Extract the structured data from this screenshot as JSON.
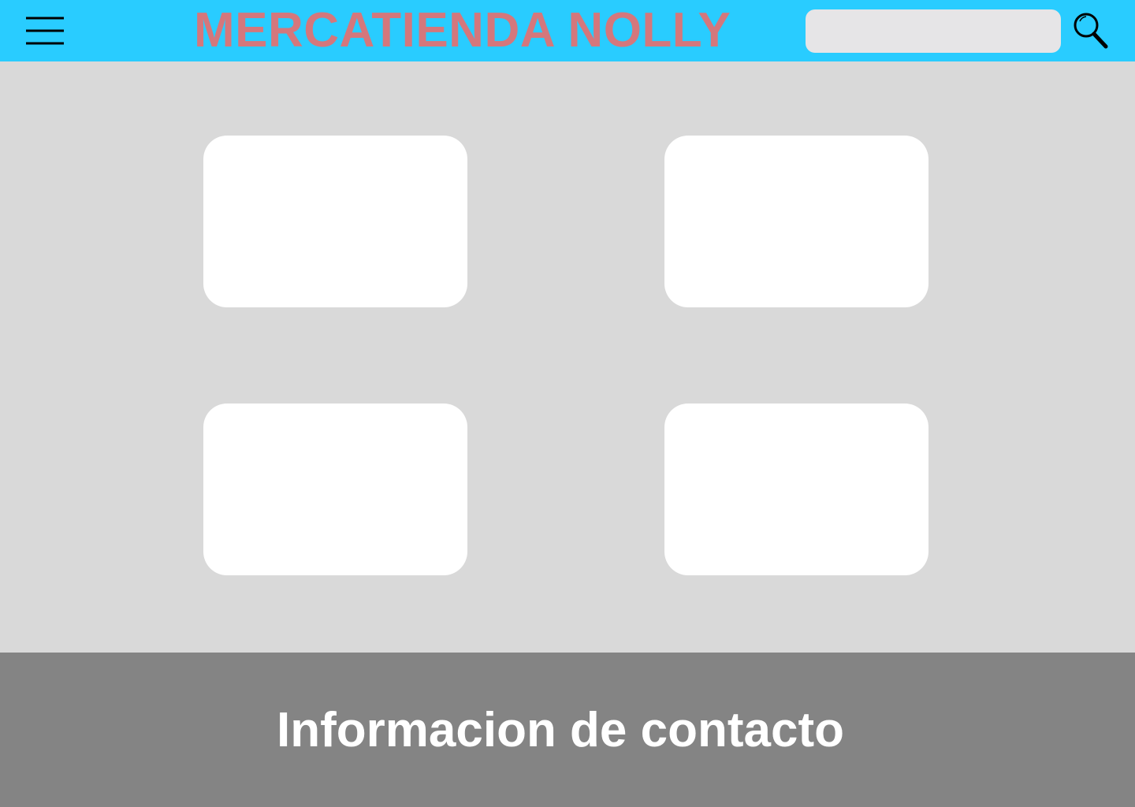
{
  "colors": {
    "header_background": "#29ccff",
    "brand_text": "#d4777c",
    "main_background": "#d9d9d9",
    "card_background": "#ffffff",
    "search_field_background": "#e6e5e7",
    "footer_background": "#848484",
    "footer_text": "#ffffff",
    "icon_stroke": "#000000"
  },
  "header": {
    "menu_icon": "hamburger-menu-icon",
    "title": "MERCATIENDA NOLLY",
    "search": {
      "value": "",
      "placeholder": ""
    },
    "search_icon": "magnifying-glass-icon"
  },
  "main": {
    "cards": [
      {
        "id": "card-1"
      },
      {
        "id": "card-2"
      },
      {
        "id": "card-3"
      },
      {
        "id": "card-4"
      }
    ]
  },
  "footer": {
    "text": "Informacion de contacto"
  }
}
